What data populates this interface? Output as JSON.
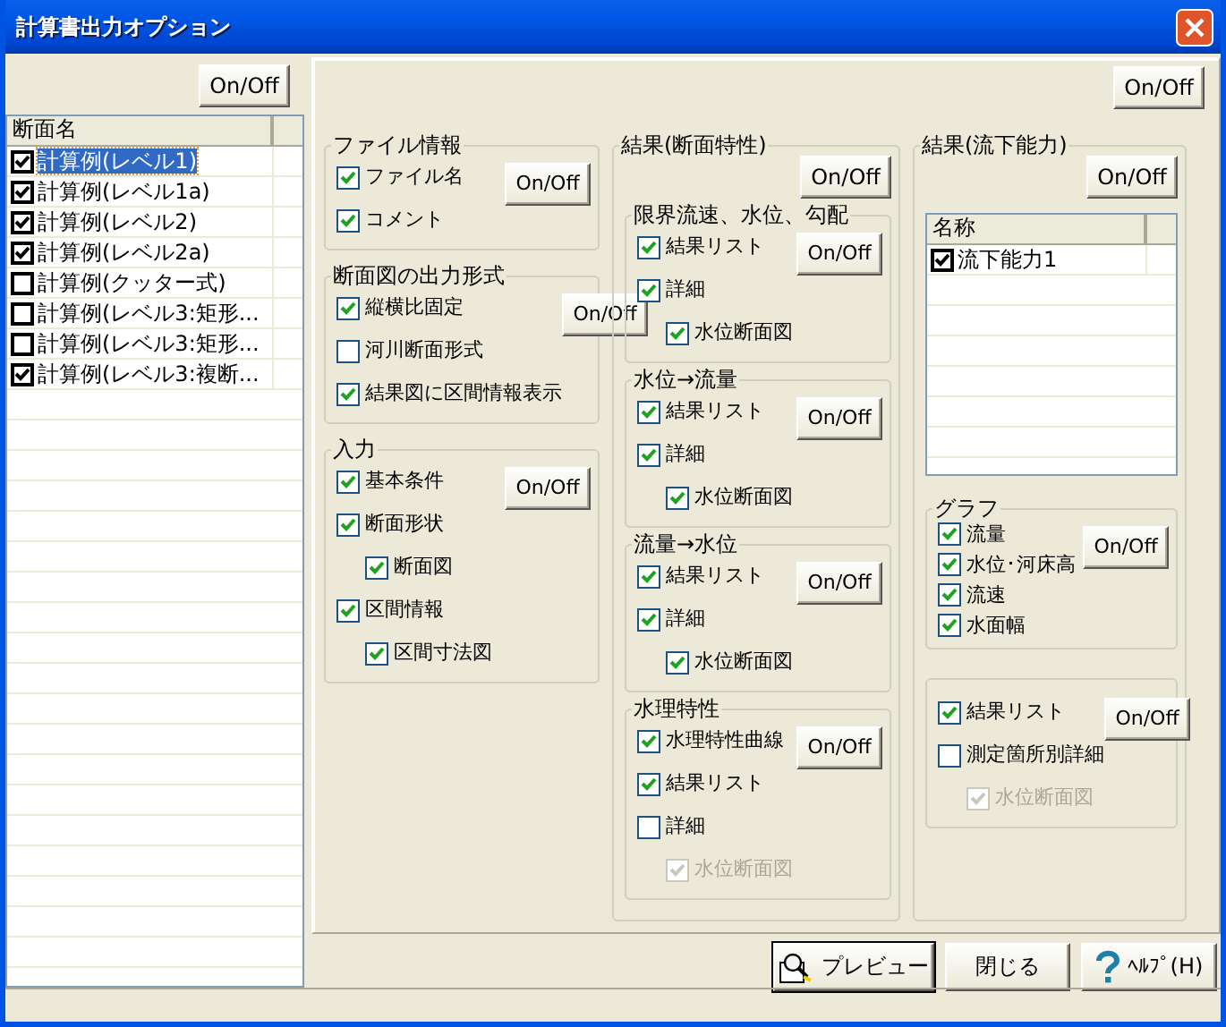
{
  "window": {
    "title": "計算書出力オプション"
  },
  "sections_panel": {
    "toggle_button": "On/Off",
    "column_header": "断面名",
    "rows": [
      {
        "label": "計算例(レベル1)",
        "checked": true,
        "selected": true
      },
      {
        "label": "計算例(レベル1a)",
        "checked": true,
        "selected": false
      },
      {
        "label": "計算例(レベル2)",
        "checked": true,
        "selected": false
      },
      {
        "label": "計算例(レベル2a)",
        "checked": true,
        "selected": false
      },
      {
        "label": "計算例(クッター式)",
        "checked": false,
        "selected": false
      },
      {
        "label": "計算例(レベル3:矩形...",
        "checked": false,
        "selected": false
      },
      {
        "label": "計算例(レベル3:矩形...",
        "checked": false,
        "selected": false
      },
      {
        "label": "計算例(レベル3:複断...",
        "checked": true,
        "selected": false
      }
    ]
  },
  "options_panel": {
    "toggle_button": "On/Off",
    "columns": [
      [
        {
          "kind": "group",
          "title": "ファイル情報",
          "button": "On/Off",
          "items": [
            {
              "label": "ファイル名",
              "checked": true,
              "disabled": false
            },
            {
              "label": "コメント",
              "checked": true,
              "disabled": false
            }
          ]
        },
        {
          "kind": "group",
          "title": "断面図の出力形式",
          "button": "On/Off",
          "items": [
            {
              "label": "縦横比固定",
              "checked": true,
              "disabled": false
            },
            {
              "label": "河川断面形式",
              "checked": false,
              "disabled": false
            },
            {
              "label": "結果図に区間情報表示",
              "checked": true,
              "disabled": false
            }
          ]
        },
        {
          "kind": "group",
          "title": "入力",
          "button": "On/Off",
          "items": [
            {
              "label": "基本条件",
              "checked": true,
              "disabled": false
            },
            {
              "label": "断面形状",
              "checked": true,
              "disabled": false,
              "children": [
                {
                  "label": "断面図",
                  "checked": true,
                  "disabled": false
                }
              ]
            },
            {
              "label": "区間情報",
              "checked": true,
              "disabled": false,
              "children": [
                {
                  "label": "区間寸法図",
                  "checked": true,
                  "disabled": false
                }
              ]
            }
          ]
        }
      ],
      [
        {
          "kind": "outer",
          "title": "結果(断面特性)",
          "button": "On/Off",
          "groups": [
            {
              "kind": "group",
              "title": "限界流速、水位、勾配",
              "button": "On/Off",
              "items": [
                {
                  "label": "結果リスト",
                  "checked": true,
                  "disabled": false
                },
                {
                  "label": "詳細",
                  "checked": true,
                  "disabled": false,
                  "children": [
                    {
                      "label": "水位断面図",
                      "checked": true,
                      "disabled": false
                    }
                  ]
                }
              ]
            },
            {
              "kind": "group",
              "title": "水位→流量",
              "button": "On/Off",
              "items": [
                {
                  "label": "結果リスト",
                  "checked": true,
                  "disabled": false
                },
                {
                  "label": "詳細",
                  "checked": true,
                  "disabled": false,
                  "children": [
                    {
                      "label": "水位断面図",
                      "checked": true,
                      "disabled": false
                    }
                  ]
                }
              ]
            },
            {
              "kind": "group",
              "title": "流量→水位",
              "button": "On/Off",
              "items": [
                {
                  "label": "結果リスト",
                  "checked": true,
                  "disabled": false
                },
                {
                  "label": "詳細",
                  "checked": true,
                  "disabled": false,
                  "children": [
                    {
                      "label": "水位断面図",
                      "checked": true,
                      "disabled": false
                    }
                  ]
                }
              ]
            },
            {
              "kind": "group",
              "title": "水理特性",
              "button": "On/Off",
              "items": [
                {
                  "label": "水理特性曲線",
                  "checked": true,
                  "disabled": false
                },
                {
                  "label": "結果リスト",
                  "checked": true,
                  "disabled": false
                },
                {
                  "label": "詳細",
                  "checked": false,
                  "disabled": false,
                  "children": [
                    {
                      "label": "水位断面図",
                      "checked": true,
                      "disabled": true
                    }
                  ]
                }
              ]
            }
          ]
        }
      ],
      [
        {
          "kind": "outer",
          "title": "結果(流下能力)",
          "button": "On/Off",
          "table": {
            "column_header": "名称",
            "rows": [
              {
                "label": "流下能力1",
                "checked": true
              }
            ]
          },
          "groups": [
            {
              "kind": "compact_group",
              "title": "グラフ",
              "button": "On/Off",
              "items": [
                {
                  "label": "流量",
                  "checked": true,
                  "disabled": false
                },
                {
                  "label": "水位･河床高",
                  "checked": true,
                  "disabled": false
                },
                {
                  "label": "流速",
                  "checked": true,
                  "disabled": false
                },
                {
                  "label": "水面幅",
                  "checked": true,
                  "disabled": false
                }
              ]
            },
            {
              "kind": "group",
              "button": "On/Off",
              "items": [
                {
                  "label": "結果リスト",
                  "checked": true,
                  "disabled": false
                },
                {
                  "label": "測定箇所別詳細",
                  "checked": false,
                  "disabled": false,
                  "children": [
                    {
                      "label": "水位断面図",
                      "checked": true,
                      "disabled": true
                    }
                  ]
                }
              ]
            }
          ]
        }
      ]
    ]
  },
  "footer_buttons": [
    {
      "label": "プレビュー",
      "kind": "preview"
    },
    {
      "label": "閉じる",
      "kind": "plain"
    },
    {
      "label": "ﾍﾙﾌﾟ(H)",
      "kind": "help"
    }
  ]
}
